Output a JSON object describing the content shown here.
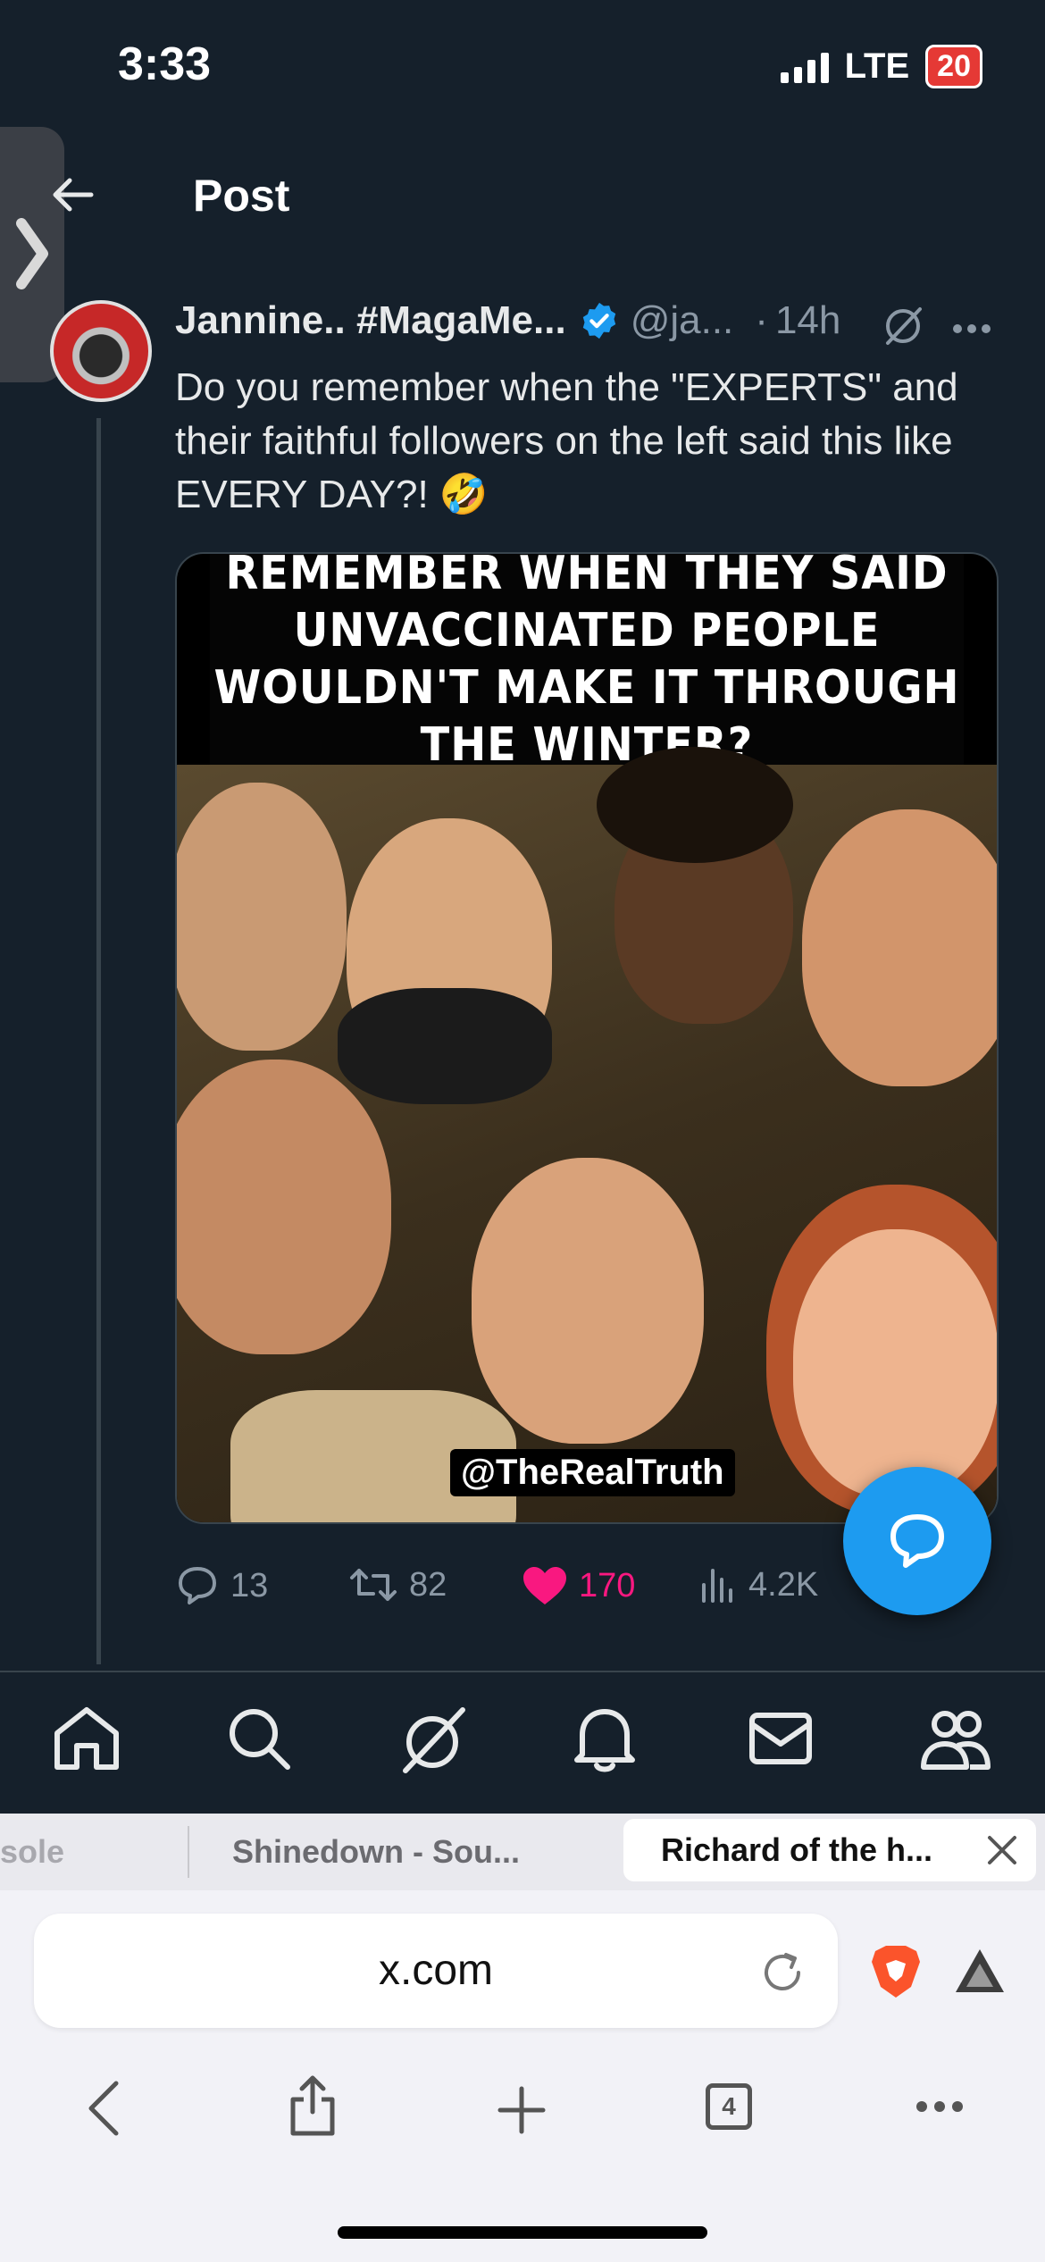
{
  "status_bar": {
    "time": "3:33",
    "network": "LTE",
    "battery": "20"
  },
  "header": {
    "title": "Post"
  },
  "post": {
    "author_name": "Jannine.. #MagaMe...",
    "handle": "@ja...",
    "separator": "·",
    "time": "14h",
    "text": "Do you remember when the \"EXPERTS\" and their faithful followers on the left said this like EVERY DAY?! 🤣",
    "media": {
      "caption": "REMEMBER WHEN THEY SAID UNVACCINATED PEOPLE WOULDN'T MAKE IT THROUGH THE WINTER?",
      "watermark": "@TheRealTruth"
    },
    "stats": {
      "replies": "13",
      "reposts": "82",
      "likes": "170",
      "views": "4.2K"
    }
  },
  "browser": {
    "tabs": [
      {
        "label": "sole"
      },
      {
        "label": "Shinedown - Sou..."
      },
      {
        "label": "Richard of the h..."
      }
    ],
    "url": "x.com",
    "tab_count": "4"
  },
  "colors": {
    "accent": "#1d9bf0",
    "like": "#f91880",
    "background": "#15202b"
  }
}
